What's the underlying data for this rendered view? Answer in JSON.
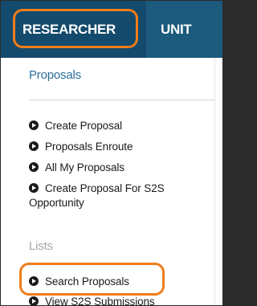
{
  "topnav": {
    "tabs": [
      {
        "label": "RESEARCHER",
        "active": true
      },
      {
        "label": "UNIT",
        "active": false
      }
    ]
  },
  "menu": {
    "sections": [
      {
        "title": "Proposals",
        "items": [
          {
            "label": "Create Proposal",
            "icon": "circle-chevron-right-icon"
          },
          {
            "label": "Proposals Enroute",
            "icon": "circle-chevron-right-icon"
          },
          {
            "label": "All My Proposals",
            "icon": "circle-chevron-right-icon"
          },
          {
            "label": "Create Proposal For S2S Opportunity",
            "icon": "circle-chevron-right-icon"
          }
        ]
      },
      {
        "title": "Lists",
        "items": [
          {
            "label": "Search Proposals",
            "icon": "circle-chevron-right-icon",
            "highlighted": true
          },
          {
            "label": "View S2S Submissions",
            "icon": "circle-chevron-right-icon"
          }
        ]
      }
    ]
  },
  "colors": {
    "nav_background": "#1c5a7e",
    "active_tab_background": "#144a6b",
    "highlight_outline": "#f07c1b",
    "section_title": "#2a6f9a",
    "section_title_muted": "#a7a7a7"
  }
}
